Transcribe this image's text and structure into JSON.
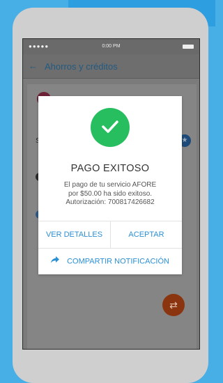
{
  "status_bar": {
    "signal": "●●●●●",
    "time": "0:00 PM"
  },
  "app_bar": {
    "back_icon": "←",
    "title": "Ahorros y créditos"
  },
  "dialog": {
    "title": "PAGO EXITOSO",
    "message_line1": "El pago de tu servicio AFORE",
    "message_line2": "por $50.00 ha sido exitoso.",
    "message_line3": "Autorización: 700817426682",
    "details_button": "VER DETALLES",
    "accept_button": "ACEPTAR",
    "share_button": "COMPARTIR NOTIFICACIÓN"
  },
  "background": {
    "letter_s": "S",
    "star": "★",
    "fab_icon": "⇄"
  },
  "colors": {
    "accent": "#2b8fd4",
    "success": "#27be60",
    "page_background": "#47aee6",
    "fab": "#8a3410"
  }
}
